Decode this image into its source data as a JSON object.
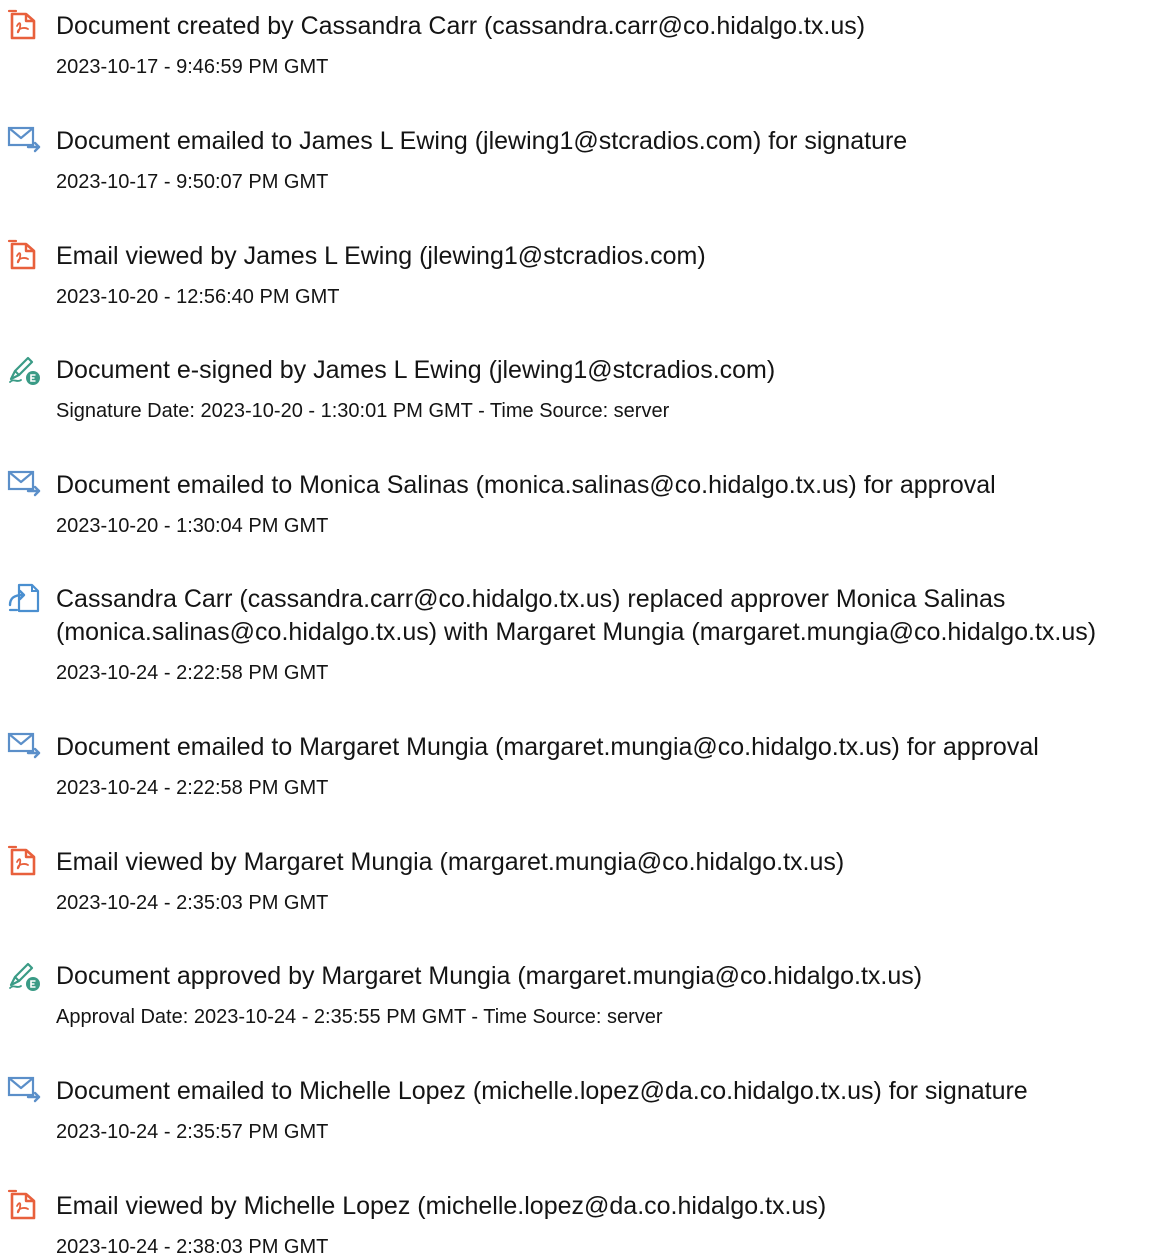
{
  "events": [
    {
      "icon": "pdf-document-icon",
      "title_lines": [
        "Document created by Cassandra Carr (cassandra.carr@co.hidalgo.tx.us)"
      ],
      "date": "2023-10-17 - 9:46:59 PM GMT"
    },
    {
      "icon": "email-sent-icon",
      "title_lines": [
        "Document emailed to James L Ewing (jlewing1@stcradios.com) for signature"
      ],
      "date": "2023-10-17 - 9:50:07 PM GMT"
    },
    {
      "icon": "pdf-document-icon",
      "title_lines": [
        "Email viewed by James L Ewing (jlewing1@stcradios.com)"
      ],
      "date": "2023-10-20 - 12:56:40 PM GMT"
    },
    {
      "icon": "pen-signed-icon",
      "title_lines": [
        "Document e-signed by James L Ewing (jlewing1@stcradios.com)"
      ],
      "date": "Signature Date: 2023-10-20 - 1:30:01 PM GMT - Time Source: server"
    },
    {
      "icon": "email-sent-icon",
      "title_lines": [
        "Document emailed to Monica Salinas (monica.salinas@co.hidalgo.tx.us) for approval"
      ],
      "date": "2023-10-20 - 1:30:04 PM GMT"
    },
    {
      "icon": "replace-document-icon",
      "title_lines": [
        "Cassandra Carr (cassandra.carr@co.hidalgo.tx.us) replaced approver Monica Salinas",
        "(monica.salinas@co.hidalgo.tx.us) with Margaret Mungia (margaret.mungia@co.hidalgo.tx.us)"
      ],
      "date": "2023-10-24 - 2:22:58 PM GMT"
    },
    {
      "icon": "email-sent-icon",
      "title_lines": [
        "Document emailed to Margaret Mungia (margaret.mungia@co.hidalgo.tx.us) for approval"
      ],
      "date": "2023-10-24 - 2:22:58 PM GMT"
    },
    {
      "icon": "pdf-document-icon",
      "title_lines": [
        "Email viewed by Margaret Mungia (margaret.mungia@co.hidalgo.tx.us)"
      ],
      "date": "2023-10-24 - 2:35:03 PM GMT"
    },
    {
      "icon": "pen-signed-icon",
      "title_lines": [
        "Document approved by Margaret Mungia (margaret.mungia@co.hidalgo.tx.us)"
      ],
      "date": "Approval Date: 2023-10-24 - 2:35:55 PM GMT - Time Source: server"
    },
    {
      "icon": "email-sent-icon",
      "title_lines": [
        "Document emailed to Michelle Lopez (michelle.lopez@da.co.hidalgo.tx.us) for signature"
      ],
      "date": "2023-10-24 - 2:35:57 PM GMT"
    },
    {
      "icon": "pdf-document-icon",
      "title_lines": [
        "Email viewed by Michelle Lopez (michelle.lopez@da.co.hidalgo.tx.us)"
      ],
      "date": "2023-10-24 - 2:38:03 PM GMT"
    }
  ],
  "colors": {
    "text": "#141414",
    "pdf_icon": "#e8603c",
    "email_icon": "#5b8fc9",
    "sign_icon": "#3a9b86",
    "replace_icon": "#4a8fd0"
  }
}
